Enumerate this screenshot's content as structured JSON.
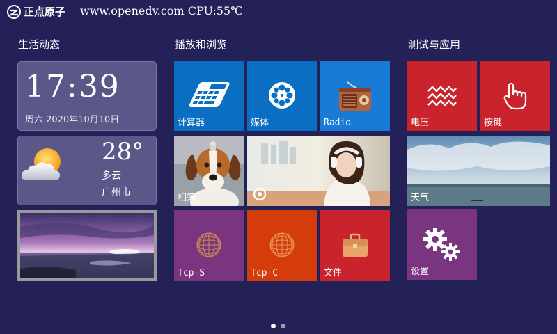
{
  "header": {
    "logo_text": "正点原子",
    "info": "www.openedv.com CPU:55℃"
  },
  "sections": {
    "life": "生活动态",
    "media": "播放和浏览",
    "test": "测试与应用"
  },
  "clock": {
    "time": "17:39",
    "date": "周六 2020年10月10日"
  },
  "weather": {
    "temperature": "28°",
    "condition": "多云",
    "city": "广州市",
    "icon": "partly-cloudy-icon"
  },
  "tiles": {
    "calculator": {
      "label": "计算器",
      "color": "#0a6fc2",
      "icon": "calculator-icon"
    },
    "media": {
      "label": "媒体",
      "color": "#0a6fc2",
      "icon": "film-reel-icon"
    },
    "radio": {
      "label": "Radio",
      "color": "#1a7bd6",
      "icon": "radio-icon"
    },
    "album": {
      "label": "相簿"
    },
    "tcp_s": {
      "label": "Tcp-S",
      "color": "#7a3581",
      "icon": "globe-icon"
    },
    "tcp_c": {
      "label": "Tcp-C",
      "color": "#d43c0c",
      "icon": "globe-icon"
    },
    "files": {
      "label": "文件",
      "color": "#c9232e",
      "icon": "briefcase-icon"
    },
    "voltage": {
      "label": "电压",
      "color": "#c9232e",
      "icon": "wave-icon"
    },
    "keys": {
      "label": "按键",
      "color": "#c9232e",
      "icon": "hand-press-icon"
    },
    "weather": {
      "label": "天气"
    },
    "settings": {
      "label": "设置",
      "color": "#7a3581",
      "icon": "gears-icon"
    }
  },
  "pager": {
    "pages": 2,
    "current": 1
  }
}
